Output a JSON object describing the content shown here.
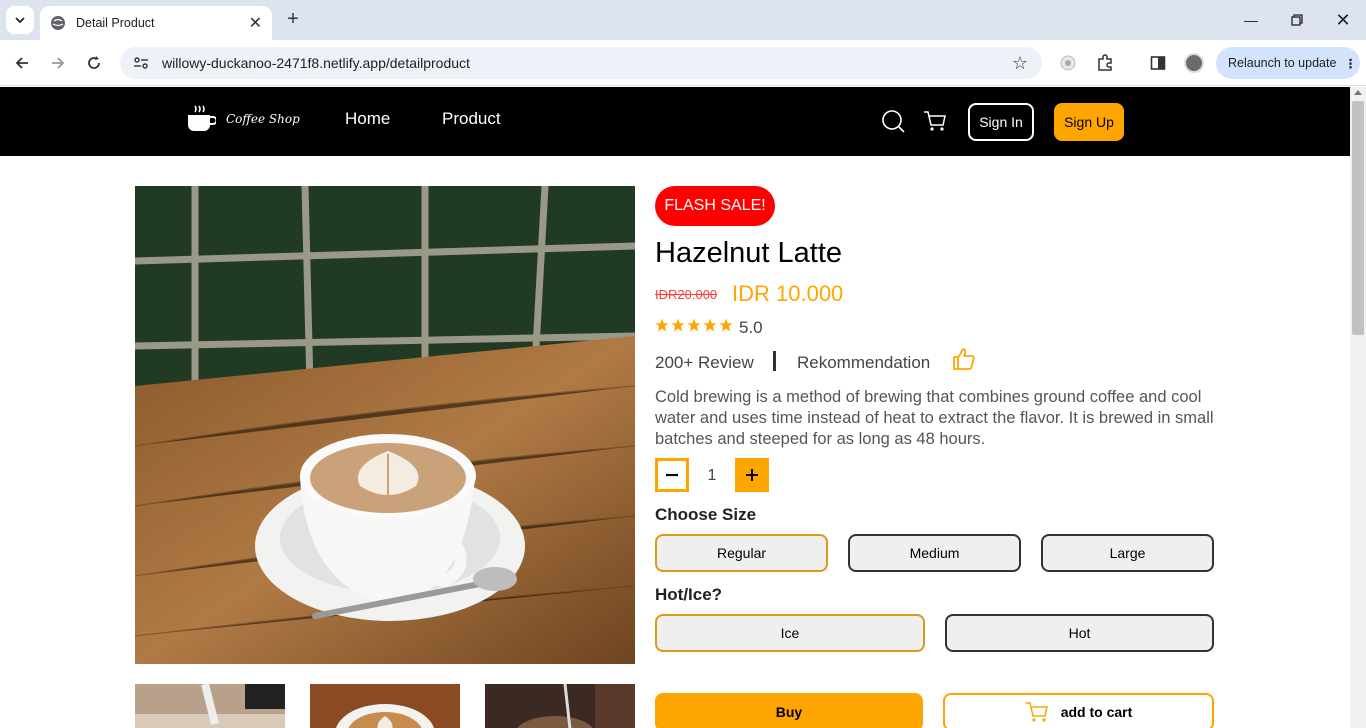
{
  "browser": {
    "tab_title": "Detail Product",
    "url": "willowy-duckanoo-2471f8.netlify.app/detailproduct",
    "relaunch_label": "Relaunch to update"
  },
  "navbar": {
    "logo_text": "Coffee Shop",
    "links": [
      "Home",
      "Product"
    ],
    "signin_label": "Sign In",
    "signup_label": "Sign Up"
  },
  "product": {
    "badge": "FLASH SALE!",
    "name": "Hazelnut Latte",
    "old_price": "IDR20.000",
    "price": "IDR 10.000",
    "rating": "5.0",
    "rating_stars": 5,
    "reviews": "200+ Review",
    "recommendation": "Rekommendation",
    "description": "Cold brewing is a method of brewing that combines ground coffee and cool water and uses time instead of heat to extract the flavor. It is brewed in small batches and steeped for as long as 48 hours.",
    "quantity": "1"
  },
  "size": {
    "label": "Choose Size",
    "options": [
      "Regular",
      "Medium",
      "Large"
    ],
    "selected": "Regular"
  },
  "temperature": {
    "label": "Hot/Ice?",
    "options": [
      "Ice",
      "Hot"
    ],
    "selected": "Ice"
  },
  "actions": {
    "buy_label": "Buy",
    "cart_label": "add to cart"
  },
  "colors": {
    "accent": "#ffa500",
    "sale": "#ff0000",
    "navbar": "#000000"
  }
}
